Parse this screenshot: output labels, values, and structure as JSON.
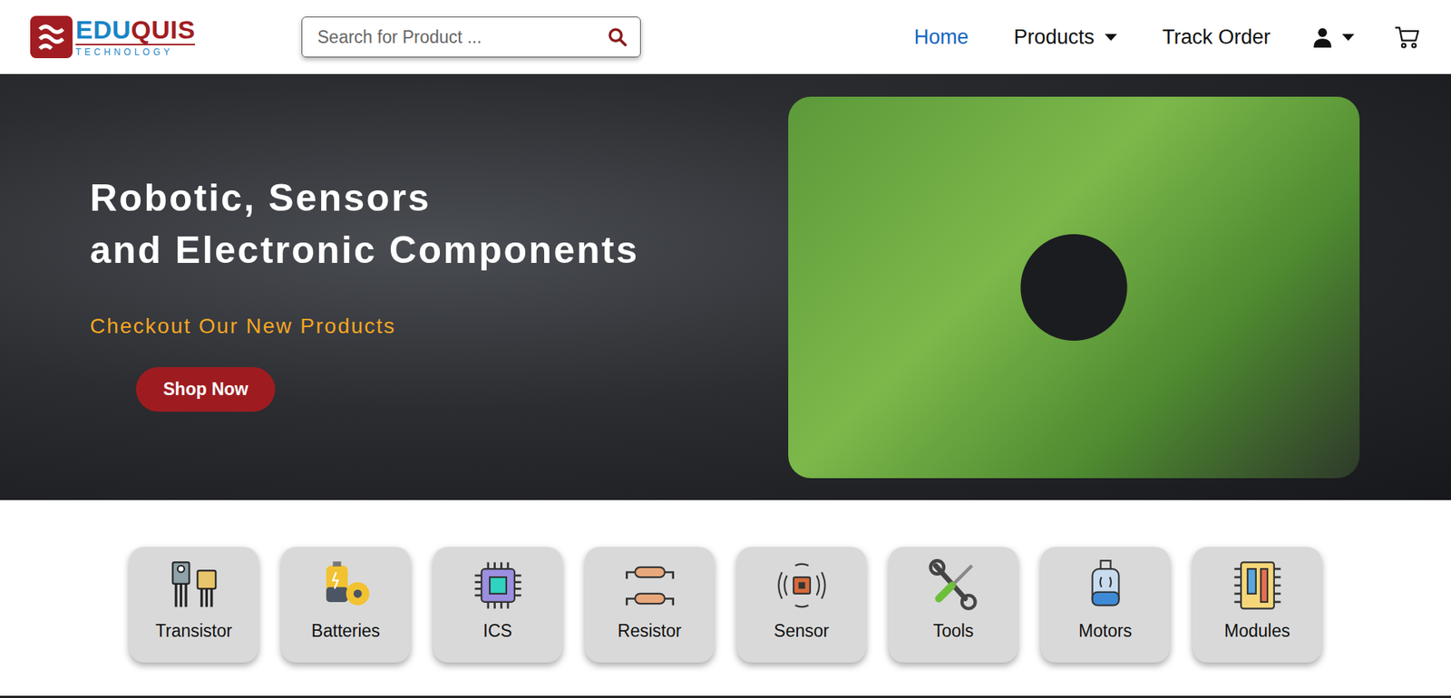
{
  "logo": {
    "parts": [
      {
        "text": "EDU",
        "color": "#1b84c6"
      },
      {
        "text": "QUIS",
        "color": "#a11d22"
      }
    ],
    "tagline": "TECHNOLOGY"
  },
  "search": {
    "placeholder": "Search for Product ..."
  },
  "nav": [
    {
      "label": "Home",
      "selected": true,
      "dropdown": false
    },
    {
      "label": "Products",
      "selected": false,
      "dropdown": true
    },
    {
      "label": "Track Order",
      "selected": false,
      "dropdown": false
    }
  ],
  "hero": {
    "title_lines": [
      "Robotic, Sensors",
      "and Electronic Components"
    ],
    "subtitle": "Checkout Our New Products",
    "button": "Shop Now"
  },
  "categories": [
    {
      "label": "Transistor"
    },
    {
      "label": "Batteries"
    },
    {
      "label": "ICS"
    },
    {
      "label": "Resistor"
    },
    {
      "label": "Sensor"
    },
    {
      "label": "Tools"
    },
    {
      "label": "Motors"
    },
    {
      "label": "Modules"
    }
  ]
}
